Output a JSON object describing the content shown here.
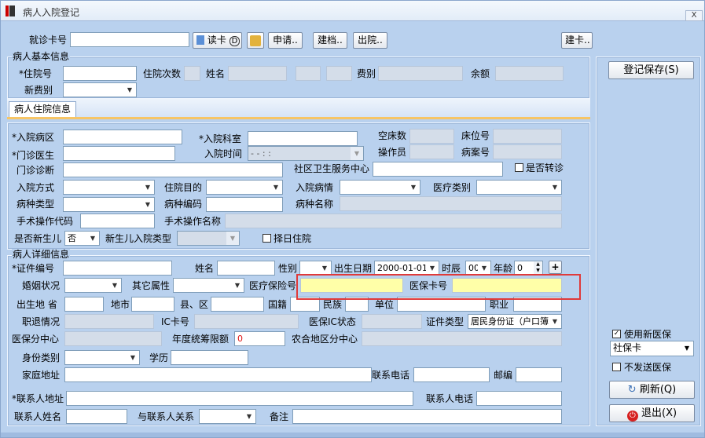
{
  "window": {
    "title": "病人入院登记",
    "close_label": "X"
  },
  "toolbar": {
    "card_label": "就诊卡号",
    "card_value": "",
    "read_card": "读卡",
    "read_card_hint": "D",
    "apply": "申请..",
    "file": "建档..",
    "discharge": "出院..",
    "build_card": "建卡.."
  },
  "basic_info": {
    "title": "病人基本信息",
    "inpatient_no": "*住院号",
    "visit_count": "住院次数",
    "name": "姓名",
    "fee_type": "费别",
    "balance": "余额",
    "new_fee_type": "新费别"
  },
  "tab": {
    "label": "病人住院信息"
  },
  "admission": {
    "ward": "*入院病区",
    "dept": "*入院科室",
    "empty_beds": "空床数",
    "bed_no": "床位号",
    "doctor": "*门诊医生",
    "admit_time": "入院时间",
    "admit_time_value": "-  -      :  :",
    "operator": "操作员",
    "record_no": "病案号",
    "diagnosis": "门诊诊断",
    "community": "社区卫生服务中心",
    "transfer": "是否转诊",
    "admit_mode": "入院方式",
    "purpose": "住院目的",
    "condition": "入院病情",
    "med_type": "医疗类别",
    "disease_type": "病种类型",
    "disease_code": "病种编码",
    "disease_name": "病种名称",
    "surgery_code": "手术操作代码",
    "surgery_name": "手术操作名称",
    "newborn": "是否新生儿",
    "newborn_value": "否",
    "newborn_type": "新生儿入院类型",
    "select_day": "择日住院"
  },
  "detail": {
    "title": "病人详细信息",
    "id_no": "*证件编号",
    "name": "姓名",
    "gender": "性别",
    "birth": "出生日期",
    "birth_value": "2000-01-01",
    "hour": "时辰",
    "hour_value": "00",
    "age": "年龄",
    "age_value": "0",
    "marital": "婚姻状况",
    "other_attr": "其它属性",
    "insurance_no": "医疗保险号",
    "insurance_card": "医保卡号",
    "birthplace": "出生地 省",
    "city": "地市",
    "county": "县、区",
    "nationality": "国籍",
    "ethnicity": "民族",
    "employer": "单位",
    "occupation": "职业",
    "job_status": "职退情况",
    "ic_card": "IC卡号",
    "ic_status": "医保IC状态",
    "id_type": "证件类型",
    "id_type_value": "居民身份证（户口簿）",
    "insurance_center": "医保分中心",
    "annual_limit": "年度统筹限额",
    "annual_limit_value": "0",
    "rural_center": "农合地区分中心",
    "identity": "身份类别",
    "education": "学历",
    "home_address": "家庭地址",
    "phone": "联系电话",
    "postcode": "邮编",
    "contact_address": "*联系人地址",
    "contact_phone": "联系人电话",
    "contact_name": "联系人姓名",
    "relation": "与联系人关系",
    "remark": "备注"
  },
  "right_panel": {
    "save": "登记保存(S)",
    "use_new_insurance": "使用新医保",
    "insurance_card_type": "社保卡",
    "no_send": "不发送医保",
    "refresh": "刷新(Q)",
    "exit": "退出(X)"
  }
}
